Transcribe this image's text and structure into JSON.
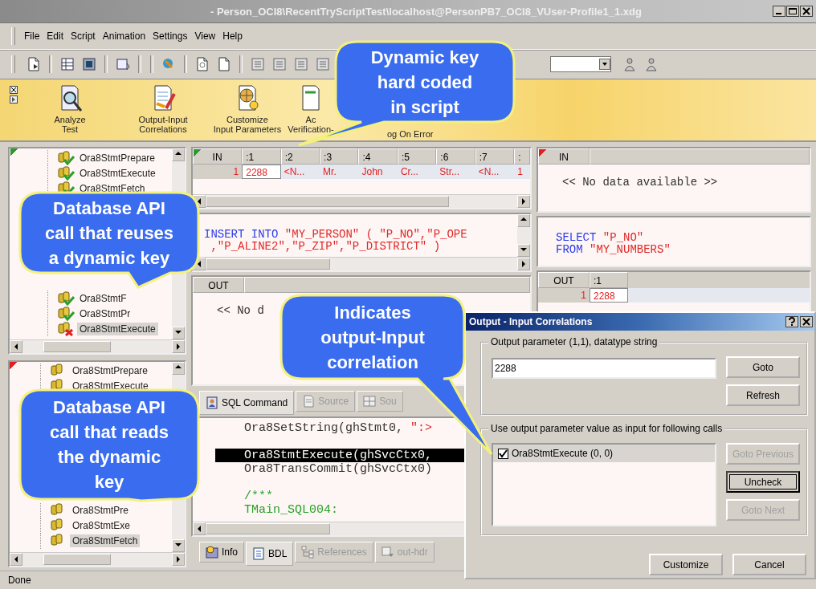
{
  "window": {
    "title": "- Person_OCI8\\RecentTryScriptTest\\localhost@PersonPB7_OCI8_VUser-Profile1_1.xdg"
  },
  "menu": [
    "File",
    "Edit",
    "Script",
    "Animation",
    "Settings",
    "View",
    "Help"
  ],
  "workflow": [
    {
      "lines": [
        "Analyze",
        "Test"
      ]
    },
    {
      "lines": [
        "Output-Input",
        "Correlations"
      ]
    },
    {
      "lines": [
        "Customize",
        "Input Parameters"
      ]
    },
    {
      "lines": [
        "Ac",
        "Verification-"
      ]
    },
    {
      "lines": [
        "og On Error"
      ]
    }
  ],
  "tree_upper": {
    "items": [
      {
        "label": "Ora8StmtPrepare",
        "kind": "ok",
        "selected": false,
        "gap_before": false
      },
      {
        "label": "Ora8StmtExecute",
        "kind": "ok",
        "selected": false,
        "gap_before": false
      },
      {
        "label": "Ora8StmtFetch",
        "kind": "ok",
        "selected": false,
        "gap_before": false
      },
      {
        "label": "Ora8StmtF",
        "kind": "ok",
        "selected": false,
        "gap_before": true
      },
      {
        "label": "Ora8StmtPr",
        "kind": "ok",
        "selected": false,
        "gap_before": false
      },
      {
        "label": "Ora8StmtExecute",
        "kind": "error",
        "selected": true,
        "gap_before": false
      }
    ]
  },
  "tree_lower": {
    "items": [
      {
        "label": "Ora8StmtPrepare",
        "kind": "plain",
        "selected": false,
        "gap_before": false
      },
      {
        "label": "Ora8StmtExecute",
        "kind": "plain",
        "selected": false,
        "gap_before": false
      },
      {
        "label": "Ora8StmtPre",
        "kind": "plain",
        "selected": false,
        "gap_before": true
      },
      {
        "label": "Ora8StmtExe",
        "kind": "plain",
        "selected": false,
        "gap_before": false
      },
      {
        "label": "Ora8StmtFetch",
        "kind": "plain",
        "selected": true,
        "gap_before": false
      }
    ]
  },
  "in_grid": {
    "columns": [
      "IN",
      ":1",
      ":2",
      ":3",
      ":4",
      ":5",
      ":6",
      ":7",
      ":"
    ],
    "rows": [
      [
        "1",
        "2288",
        "<N...",
        "Mr.",
        "John",
        "Cr...",
        "Str...",
        "<N...",
        "1"
      ]
    ]
  },
  "sql_upper": {
    "lines": [
      [
        {
          "kind": "keyword",
          "text": "INSERT INTO"
        },
        {
          "kind": "string",
          "text": " \"MY_PERSON\" ( \"P_NO\",\"P_OPE"
        }
      ],
      [
        {
          "kind": "string",
          "text": " ,\"P_ALINE2\",\"P_ZIP\",\"P_DISTRICT\" )"
        }
      ]
    ]
  },
  "out_pane": {
    "columns": [
      "OUT"
    ],
    "message": "<< No d"
  },
  "mid_tabs": [
    {
      "label": "SQL Command",
      "selected": true,
      "disabled": false
    },
    {
      "label": "Source",
      "selected": false,
      "disabled": true
    },
    {
      "label": "Sou",
      "selected": false,
      "disabled": true
    }
  ],
  "code": {
    "lines": [
      {
        "selected": false,
        "blank_before": false,
        "segments": [
          {
            "kind": "plain",
            "text": "Ora8SetString(ghStmt0, "
          },
          {
            "kind": "string",
            "text": "\":>"
          }
        ]
      },
      {
        "selected": true,
        "blank_before": true,
        "segments": [
          {
            "kind": "plain",
            "text": "Ora8StmtExecute(ghSvcCtx0,"
          }
        ]
      },
      {
        "selected": false,
        "blank_before": false,
        "segments": [
          {
            "kind": "plain",
            "text": "Ora8TransCommit(ghSvcCtx0)"
          }
        ]
      },
      {
        "selected": false,
        "blank_before": true,
        "segments": [
          {
            "kind": "comment",
            "text": "/***"
          }
        ]
      },
      {
        "selected": false,
        "blank_before": false,
        "segments": [
          {
            "kind": "comment",
            "text": "TMain_SQL004:"
          }
        ]
      }
    ]
  },
  "bottom_tabs": [
    {
      "label": "Info",
      "selected": false,
      "disabled": false
    },
    {
      "label": "BDL",
      "selected": true,
      "disabled": false
    },
    {
      "label": "References",
      "selected": false,
      "disabled": true
    },
    {
      "label": "out-hdr",
      "selected": false,
      "disabled": true
    }
  ],
  "right_in": {
    "columns": [
      "IN"
    ],
    "message": "<< No data available >>"
  },
  "right_sql": {
    "lines": [
      [
        {
          "kind": "keyword",
          "text": "SELECT"
        },
        {
          "kind": "string",
          "text": " \"P_NO\""
        }
      ],
      [
        {
          "kind": "keyword",
          "text": "FROM"
        },
        {
          "kind": "string",
          "text": " \"MY_NUMBERS\""
        }
      ]
    ]
  },
  "right_out": {
    "columns": [
      "OUT",
      ":1"
    ],
    "rows": [
      [
        "1",
        "2288"
      ]
    ]
  },
  "dialog": {
    "title": "Output - Input Correlations",
    "output_group": {
      "legend": "Output parameter (1,1), datatype string",
      "value": "2288",
      "buttons": [
        {
          "label": "Goto",
          "disabled": false,
          "focused": false
        },
        {
          "label": "Refresh",
          "disabled": false,
          "focused": false
        }
      ]
    },
    "calls_group": {
      "legend": "Use output parameter value as input for following calls",
      "items": [
        {
          "label": "Ora8StmtExecute (0, 0)",
          "checked": true,
          "selected": true
        }
      ],
      "buttons": [
        {
          "label": "Goto Previous",
          "disabled": true,
          "focused": false
        },
        {
          "label": "Uncheck",
          "disabled": false,
          "focused": true
        },
        {
          "label": "Goto Next",
          "disabled": true,
          "focused": false
        }
      ]
    },
    "buttons": [
      {
        "label": "Customize",
        "disabled": false,
        "focused": false
      },
      {
        "label": "Cancel",
        "disabled": false,
        "focused": false
      }
    ]
  },
  "callouts": [
    {
      "text": "Dynamic key hard coded in script"
    },
    {
      "text": "Database API call that reuses a dynamic key"
    },
    {
      "text": "Indicates output-Input correlation"
    },
    {
      "text": "Database API call that reads the dynamic key"
    }
  ],
  "status_bar": {
    "text": "Done"
  }
}
